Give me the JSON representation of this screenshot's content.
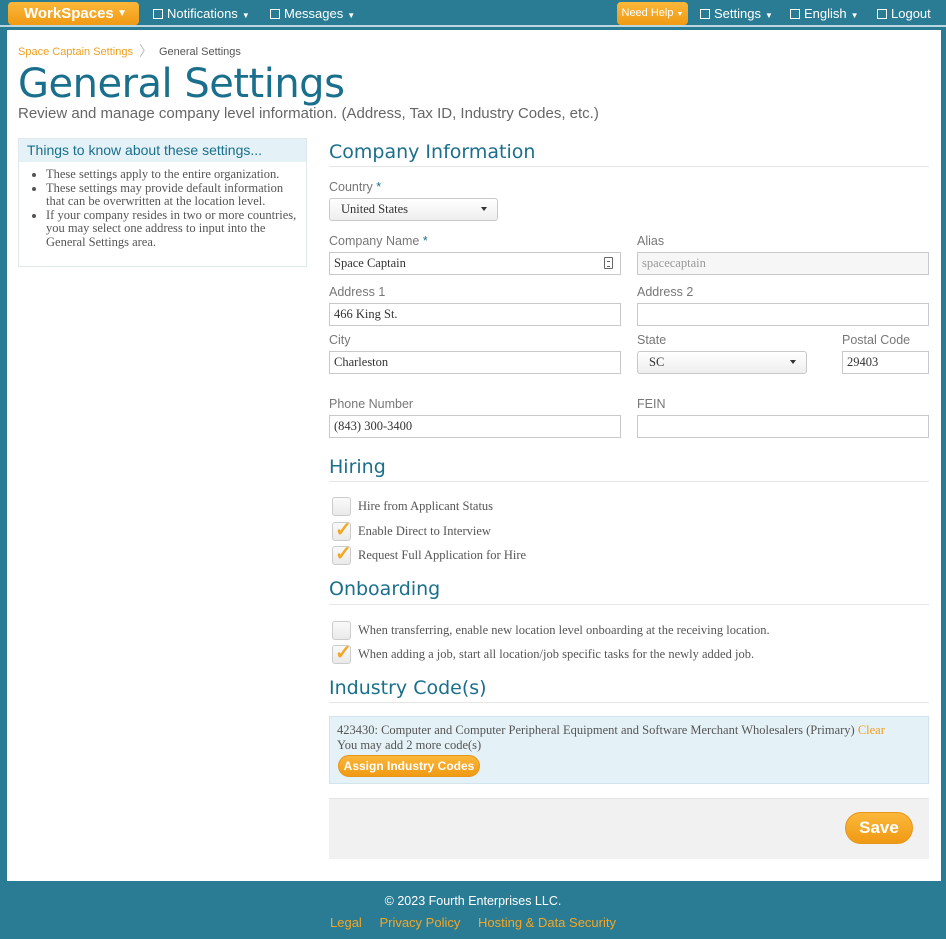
{
  "topbar": {
    "workspaces_label": "WorkSpaces",
    "notifications_label": "Notifications",
    "messages_label": "Messages",
    "need_help_label": "Need Help",
    "settings_label": "Settings",
    "language_label": "English",
    "logout_label": "Logout"
  },
  "breadcrumb": {
    "parent": "Space Captain Settings",
    "current": "General Settings"
  },
  "page": {
    "title": "General Settings",
    "subtitle": "Review and manage company level information. (Address, Tax ID, Industry Codes, etc.)"
  },
  "infobox": {
    "heading": "Things to know about these settings...",
    "items": [
      "These settings apply to the entire organization.",
      "These settings may provide default information that can be overwritten at the location level.",
      "If your company resides in two or more countries, you may select one address to input into the General Settings area."
    ]
  },
  "company": {
    "section_title": "Company Information",
    "country_label": "Country",
    "country_value": "United States",
    "required_mark": "*",
    "company_name_label": "Company Name",
    "company_name_value": "Space Captain",
    "alias_label": "Alias",
    "alias_value": "spacecaptain",
    "address1_label": "Address 1",
    "address1_value": "466 King St.",
    "address2_label": "Address 2",
    "address2_value": "",
    "city_label": "City",
    "city_value": "Charleston",
    "state_label": "State",
    "state_value": "SC",
    "postal_label": "Postal Code",
    "postal_value": "29403",
    "phone_label": "Phone Number",
    "phone_value": "(843) 300-3400",
    "fein_label": "FEIN",
    "fein_value": ""
  },
  "hiring": {
    "section_title": "Hiring",
    "options": [
      {
        "label": "Hire from Applicant Status",
        "checked": false
      },
      {
        "label": "Enable Direct to Interview",
        "checked": true
      },
      {
        "label": "Request Full Application for Hire",
        "checked": true
      }
    ]
  },
  "onboarding": {
    "section_title": "Onboarding",
    "options": [
      {
        "label": "When transferring, enable new location level onboarding at the receiving location.",
        "checked": false
      },
      {
        "label": "When adding a job, start all location/job specific tasks for the newly added job.",
        "checked": true
      }
    ]
  },
  "industry": {
    "section_title": "Industry Code(s)",
    "code_text": "423430: Computer and Computer Peripheral Equipment and Software Merchant Wholesalers (Primary)",
    "clear_label": "Clear",
    "remaining_text": "You may add 2 more code(s)",
    "assign_label": "Assign Industry Codes"
  },
  "save_label": "Save",
  "footer": {
    "copyright": "© 2023 Fourth Enterprises LLC.",
    "links": [
      "Legal",
      "Privacy Policy",
      "Hosting & Data Security"
    ]
  },
  "colors": {
    "brand_teal": "#2a7c94",
    "accent_orange": "#f5a623",
    "heading_blue": "#1a6f8c"
  }
}
